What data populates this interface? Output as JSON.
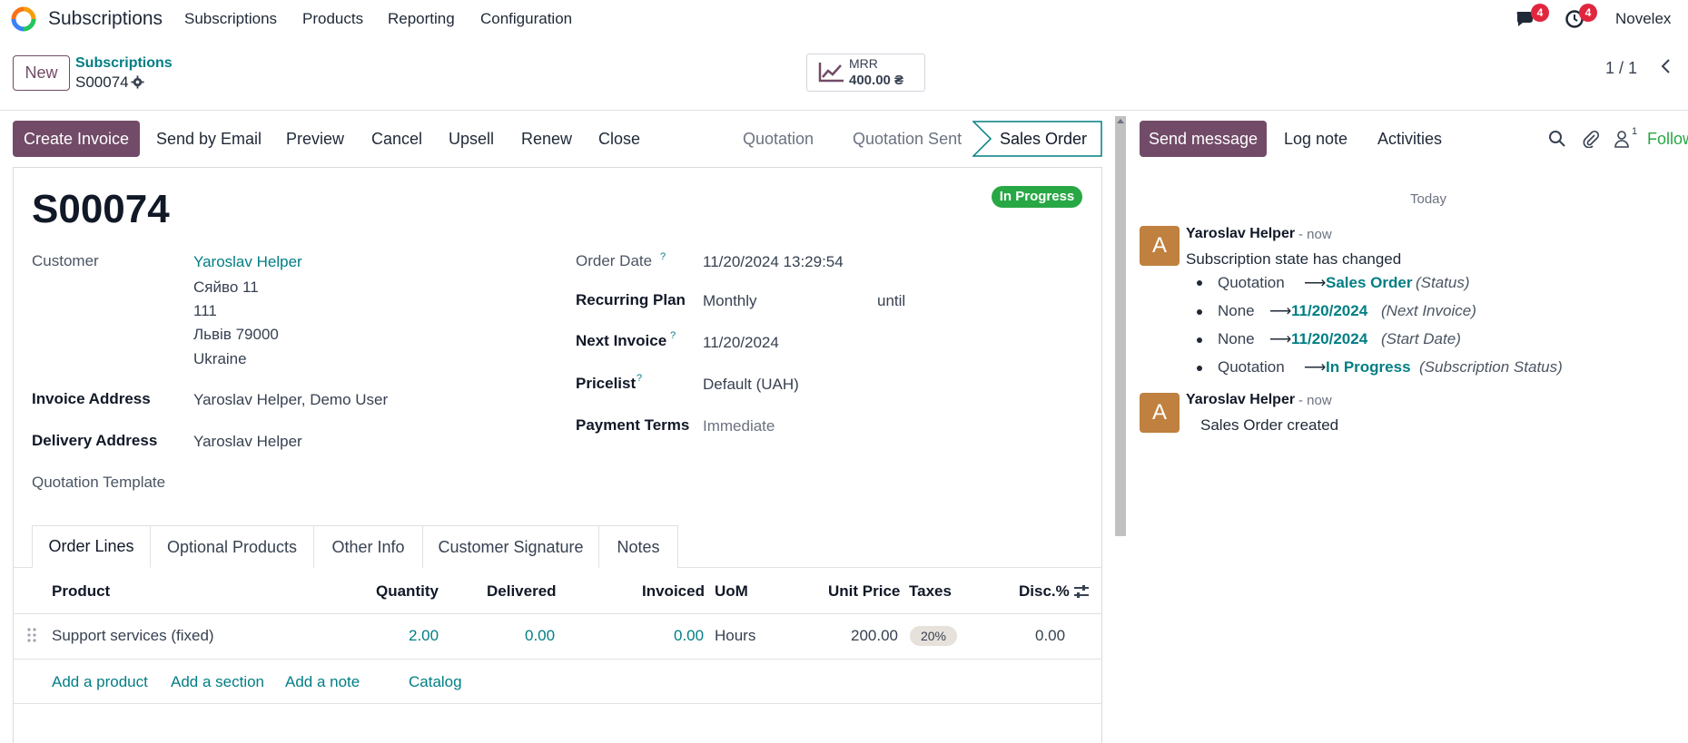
{
  "nav": {
    "app_name": "Subscriptions",
    "menu": [
      "Subscriptions",
      "Products",
      "Reporting",
      "Configuration"
    ],
    "messages_count": "4",
    "activities_count": "4",
    "company": "Novelex"
  },
  "control": {
    "new_label": "New",
    "breadcrumb_parent": "Subscriptions",
    "breadcrumb_current": "S00074",
    "mrr_label": "MRR",
    "mrr_value": "400.00 ₴",
    "pager": "1 / 1"
  },
  "actions": {
    "create_invoice": "Create Invoice",
    "send_email": "Send by Email",
    "preview": "Preview",
    "cancel": "Cancel",
    "upsell": "Upsell",
    "renew": "Renew",
    "close": "Close"
  },
  "stages": {
    "quotation": "Quotation",
    "quotation_sent": "Quotation Sent",
    "sales_order": "Sales Order",
    "active_stage": "Sales Order"
  },
  "form": {
    "title": "S00074",
    "status_badge": "In Progress",
    "customer_label": "Customer",
    "customer_name": "Yaroslav Helper",
    "customer_address": [
      "Сяйво 11",
      "111",
      "Львів 79000",
      "Ukraine"
    ],
    "invoice_address_label": "Invoice Address",
    "invoice_address": "Yaroslav Helper, Demo User",
    "delivery_address_label": "Delivery Address",
    "delivery_address": "Yaroslav Helper",
    "quotation_template_label": "Quotation Template",
    "order_date_label": "Order Date",
    "order_date": "11/20/2024 13:29:54",
    "recurring_plan_label": "Recurring Plan",
    "recurring_plan": "Monthly",
    "until_label": "until",
    "next_invoice_label": "Next Invoice",
    "next_invoice": "11/20/2024",
    "pricelist_label": "Pricelist",
    "pricelist": "Default (UAH)",
    "payment_terms_label": "Payment Terms",
    "payment_terms_placeholder": "Immediate",
    "help_mark": "?"
  },
  "tabs": [
    "Order Lines",
    "Optional Products",
    "Other Info",
    "Customer Signature",
    "Notes"
  ],
  "table": {
    "headers": {
      "product": "Product",
      "quantity": "Quantity",
      "delivered": "Delivered",
      "invoiced": "Invoiced",
      "uom": "UoM",
      "unit_price": "Unit Price",
      "taxes": "Taxes",
      "disc": "Disc.%"
    },
    "rows": [
      {
        "product": "Support services (fixed)",
        "quantity": "2.00",
        "delivered": "0.00",
        "invoiced": "0.00",
        "uom": "Hours",
        "unit_price": "200.00",
        "taxes": "20%",
        "disc": "0.00"
      }
    ],
    "add_product": "Add a product",
    "add_section": "Add a section",
    "add_note": "Add a note",
    "catalog": "Catalog"
  },
  "chatter": {
    "send_message": "Send message",
    "log_note": "Log note",
    "activities": "Activities",
    "followers_count": "1",
    "follow": "Follow",
    "date_separator": "Today",
    "messages": [
      {
        "avatar": "A",
        "author": "Yaroslav Helper",
        "when": "- now",
        "body": "Subscription state has changed",
        "changes": [
          {
            "old": "Quotation",
            "new": "Sales Order",
            "field": "(Status)"
          },
          {
            "old": "None",
            "new": "11/20/2024",
            "field": "(Next Invoice)"
          },
          {
            "old": "None",
            "new": "11/20/2024",
            "field": "(Start Date)"
          },
          {
            "old": "Quotation",
            "new": "In Progress",
            "field": "(Subscription Status)"
          }
        ]
      },
      {
        "avatar": "A",
        "author": "Yaroslav Helper",
        "when": "- now",
        "body": "Sales Order created"
      }
    ]
  },
  "colors": {
    "primary": "#714b67",
    "link": "#017e84",
    "success": "#28a745",
    "badge": "#e0263e"
  },
  "icons": [
    "app-logo-icon",
    "chat-icon",
    "clock-icon",
    "gear-icon",
    "trend-chart-icon",
    "chevron-left-icon",
    "search-icon",
    "paperclip-icon",
    "user-icon",
    "drag-handle-icon",
    "column-settings-icon"
  ]
}
